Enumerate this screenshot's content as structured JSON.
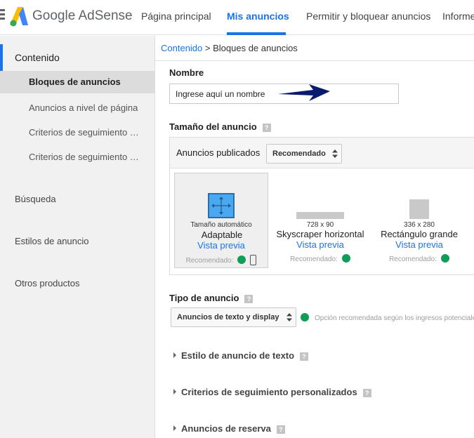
{
  "header": {
    "brand": "Google AdSense",
    "tabs": [
      {
        "label": "Página principal"
      },
      {
        "label": "Mis anuncios"
      },
      {
        "label": "Permitir y bloquear anuncios"
      },
      {
        "label": "Informes"
      }
    ]
  },
  "sidebar": {
    "section": "Contenido",
    "sub_items": [
      {
        "label": "Bloques de anuncios"
      },
      {
        "label": "Anuncios a nivel de página"
      },
      {
        "label": "Criterios de seguimiento personalizados"
      },
      {
        "label": "Criterios de seguimiento de URL"
      }
    ],
    "items": [
      {
        "label": "Búsqueda"
      },
      {
        "label": "Estilos de anuncio"
      },
      {
        "label": "Otros productos"
      }
    ]
  },
  "breadcrumb": {
    "link": "Contenido",
    "separator": " > ",
    "current": "Bloques de anuncios"
  },
  "form": {
    "name_label": "Nombre",
    "name_placeholder": "Ingrese aquí un nombre",
    "size_label": "Tamaño del anuncio",
    "published_label": "Anuncios publicados",
    "published_select": "Recomendado",
    "cards": [
      {
        "size": "Tamaño automático",
        "name": "Adaptable",
        "preview": "Vista previa",
        "recommended": "Recomendado:"
      },
      {
        "size": "728 x 90",
        "name": "Skyscraper horizontal",
        "preview": "Vista previa",
        "recommended": "Recomendado:"
      },
      {
        "size": "336 x 280",
        "name": "Rectángulo grande",
        "preview": "Vista previa",
        "recommended": "Recomendado:"
      }
    ],
    "type_label": "Tipo de anuncio",
    "type_select": "Anuncios de texto y display",
    "type_note": "Opción recomendada según los ingresos potenciales",
    "collapsibles": [
      {
        "label": "Estilo de anuncio de texto"
      },
      {
        "label": "Criterios de seguimiento personalizados"
      },
      {
        "label": "Anuncios de reserva"
      }
    ],
    "help_glyph": "?"
  },
  "colors": {
    "accent": "#1a73e8",
    "check_green": "#0f9d58",
    "annotation_arrow": "#0a1a6e"
  }
}
